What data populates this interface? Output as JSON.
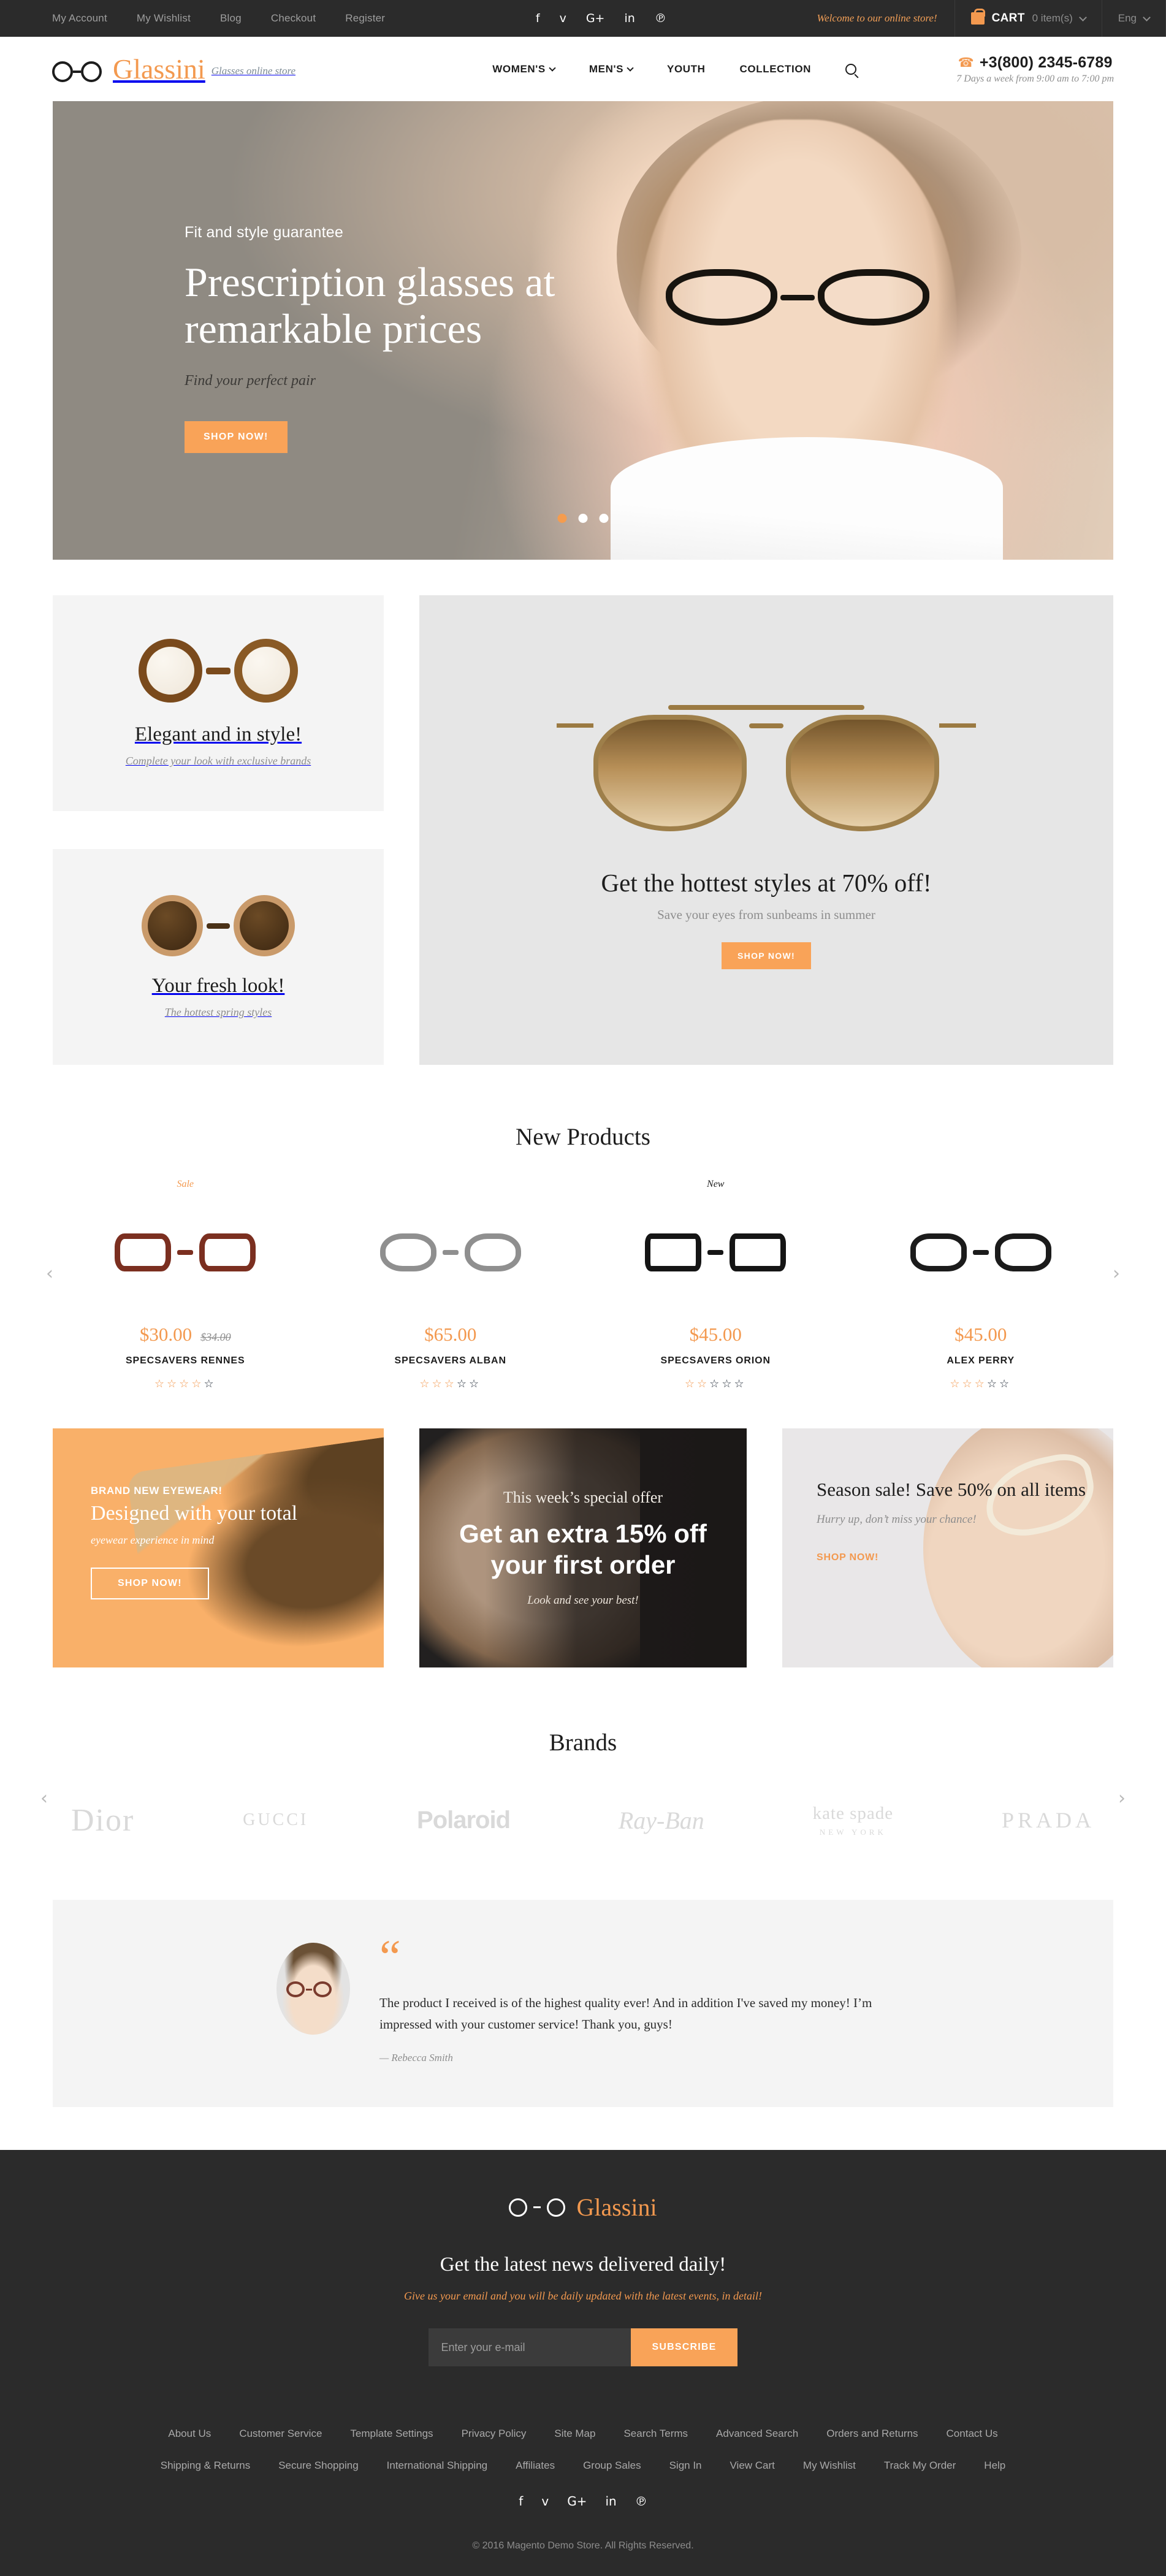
{
  "topbar": {
    "links": [
      {
        "label": "My Account"
      },
      {
        "label": "My Wishlist"
      },
      {
        "label": "Blog"
      },
      {
        "label": "Checkout"
      },
      {
        "label": "Register"
      }
    ],
    "social": [
      {
        "name": "facebook-icon",
        "glyph": "f"
      },
      {
        "name": "twitter-icon",
        "glyph": "ᴠ"
      },
      {
        "name": "google-plus-icon",
        "glyph": "G+"
      },
      {
        "name": "linkedin-icon",
        "glyph": "in"
      },
      {
        "name": "pinterest-icon",
        "glyph": "℗"
      }
    ],
    "welcome": "Welcome to our online store!",
    "cart_label": "CART",
    "cart_count": "0 item(s)",
    "language": "Eng"
  },
  "header": {
    "logo_text": "Glassini",
    "logo_tagline": "Glasses online store",
    "nav": [
      {
        "label": "WOMEN'S",
        "has_caret": true
      },
      {
        "label": "MEN'S",
        "has_caret": true
      },
      {
        "label": "YOUTH",
        "has_caret": false
      },
      {
        "label": "COLLECTION",
        "has_caret": false
      }
    ],
    "phone": "+3(800) 2345-6789",
    "hours": "7 Days a week from 9:00 am to 7:00 pm"
  },
  "hero": {
    "kicker": "Fit and style guarantee",
    "title": "Prescription glasses at remarkable prices",
    "subtitle": "Find your perfect pair",
    "cta": "SHOP NOW!",
    "slides": 3,
    "active_slide": 1
  },
  "promos": {
    "left": [
      {
        "title": "Elegant and in style!",
        "subtitle": "Complete your look with exclusive brands"
      },
      {
        "title": "Your fresh look!",
        "subtitle": "The hottest spring styles"
      }
    ],
    "right": {
      "title": "Get the hottest styles at 70% off!",
      "subtitle": "Save your eyes from sunbeams in summer",
      "cta": "SHOP NOW!"
    }
  },
  "new_products": {
    "heading": "New Products",
    "prev": "‹",
    "next": "›",
    "items": [
      {
        "badge": "Sale",
        "badge_type": "sale",
        "price": "$30.00",
        "old_price": "$34.00",
        "name": "SPECSAVERS RENNES",
        "rating": 4
      },
      {
        "badge": "",
        "badge_type": "none",
        "price": "$65.00",
        "old_price": "",
        "name": "SPECSAVERS ALBAN",
        "rating": 3
      },
      {
        "badge": "New",
        "badge_type": "new",
        "price": "$45.00",
        "old_price": "",
        "name": "SPECSAVERS ORION",
        "rating": 2
      },
      {
        "badge": "",
        "badge_type": "none",
        "price": "$45.00",
        "old_price": "",
        "name": "ALEX PERRY",
        "rating": 3
      }
    ]
  },
  "banners": {
    "one": {
      "kicker": "BRAND NEW EYEWEAR!",
      "title": "Designed with your total",
      "subtitle": "eyewear experience in mind",
      "cta": "SHOP NOW!"
    },
    "two": {
      "kicker": "This week’s special offer",
      "title": "Get an extra 15% off your first order",
      "subtitle": "Look and see your best!"
    },
    "three": {
      "title": "Season sale! Save 50% on all items",
      "subtitle": "Hurry up, don’t miss your chance!",
      "cta": "SHOP NOW!"
    }
  },
  "brands": {
    "heading": "Brands",
    "prev": "‹",
    "next": "›",
    "items": [
      {
        "name": "Dior",
        "style": "b-dior"
      },
      {
        "name": "GUCCI",
        "style": "b-gucci"
      },
      {
        "name": "Polaroid",
        "style": "b-polaroid"
      },
      {
        "name": "Ray-Ban",
        "style": "b-rayban"
      },
      {
        "name": "kate spade",
        "sub": "NEW YORK",
        "style": "b-kate"
      },
      {
        "name": "PRADA",
        "style": "b-prada"
      }
    ]
  },
  "testimonial": {
    "quote_mark": "“",
    "text": "The product I received is of the highest quality ever! And in addition I've saved my money! I’m impressed with your customer service! Thank you, guys!",
    "author": "— Rebecca Smith"
  },
  "footer": {
    "logo_text": "Glassini",
    "news_title": "Get the latest news delivered daily!",
    "news_sub": "Give us your email and you will be daily updated with the latest events, in detail!",
    "email_placeholder": "Enter your e-mail",
    "subscribe_label": "SUBSCRIBE",
    "links_row1": [
      {
        "label": "About Us"
      },
      {
        "label": "Customer Service"
      },
      {
        "label": "Template Settings"
      },
      {
        "label": "Privacy Policy"
      },
      {
        "label": "Site Map"
      },
      {
        "label": "Search Terms"
      },
      {
        "label": "Advanced Search"
      },
      {
        "label": "Orders and Returns"
      },
      {
        "label": "Contact Us"
      }
    ],
    "links_row2": [
      {
        "label": "Shipping & Returns"
      },
      {
        "label": "Secure Shopping"
      },
      {
        "label": "International Shipping"
      },
      {
        "label": "Affiliates"
      },
      {
        "label": "Group Sales"
      },
      {
        "label": "Sign In"
      },
      {
        "label": "View Cart"
      },
      {
        "label": "My Wishlist"
      },
      {
        "label": "Track My Order"
      },
      {
        "label": "Help"
      }
    ],
    "social": [
      {
        "name": "facebook-icon",
        "glyph": "f"
      },
      {
        "name": "twitter-icon",
        "glyph": "ᴠ"
      },
      {
        "name": "google-plus-icon",
        "glyph": "G+"
      },
      {
        "name": "linkedin-icon",
        "glyph": "in"
      },
      {
        "name": "pinterest-icon",
        "glyph": "℗"
      }
    ],
    "copyright": "© 2016 Magento Demo Store. All Rights Reserved."
  },
  "colors": {
    "accent": "#f3994f",
    "dark": "#2b2b2b",
    "light_panel": "#f4f4f4"
  }
}
